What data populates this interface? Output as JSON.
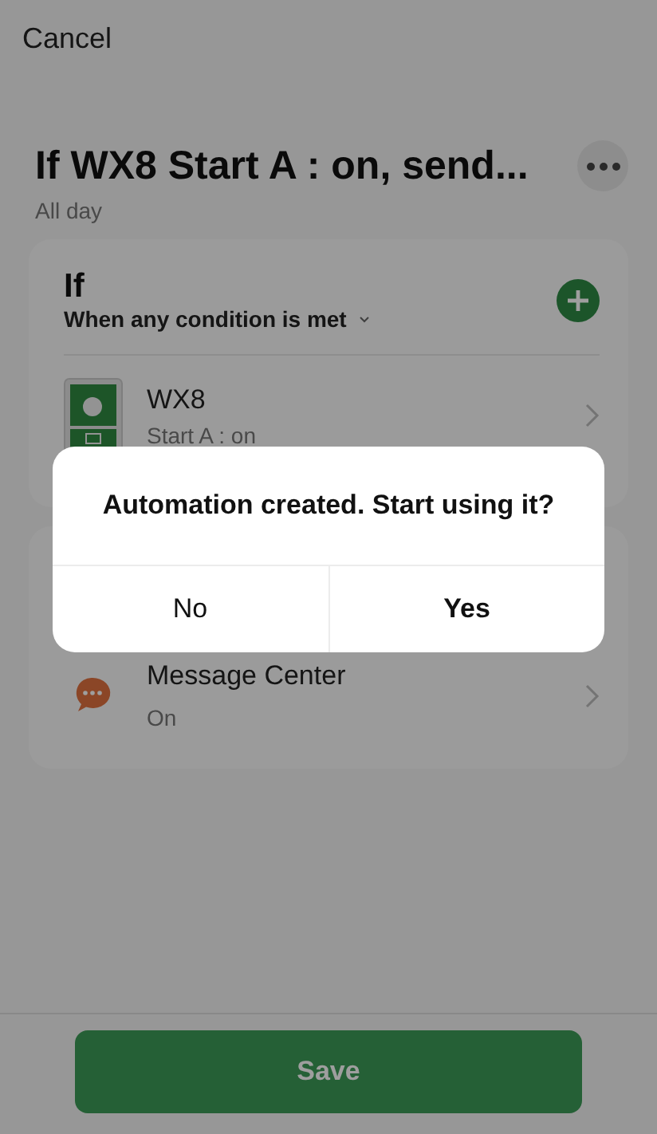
{
  "header": {
    "cancel": "Cancel"
  },
  "title": "If WX8 Start A : on, send...",
  "subtitle": "All day",
  "condition_card": {
    "heading": "If",
    "mode": "When any condition is met",
    "items": [
      {
        "kind": "device",
        "name": "WX8",
        "detail": "Start A : on"
      }
    ]
  },
  "action_card": {
    "items": [
      {
        "kind": "message",
        "name": "Message Center",
        "detail": "On"
      }
    ]
  },
  "save": "Save",
  "dialog": {
    "message": "Automation created. Start using it?",
    "buttons": [
      {
        "label": "No",
        "emphasis": false
      },
      {
        "label": "Yes",
        "emphasis": true
      }
    ]
  }
}
